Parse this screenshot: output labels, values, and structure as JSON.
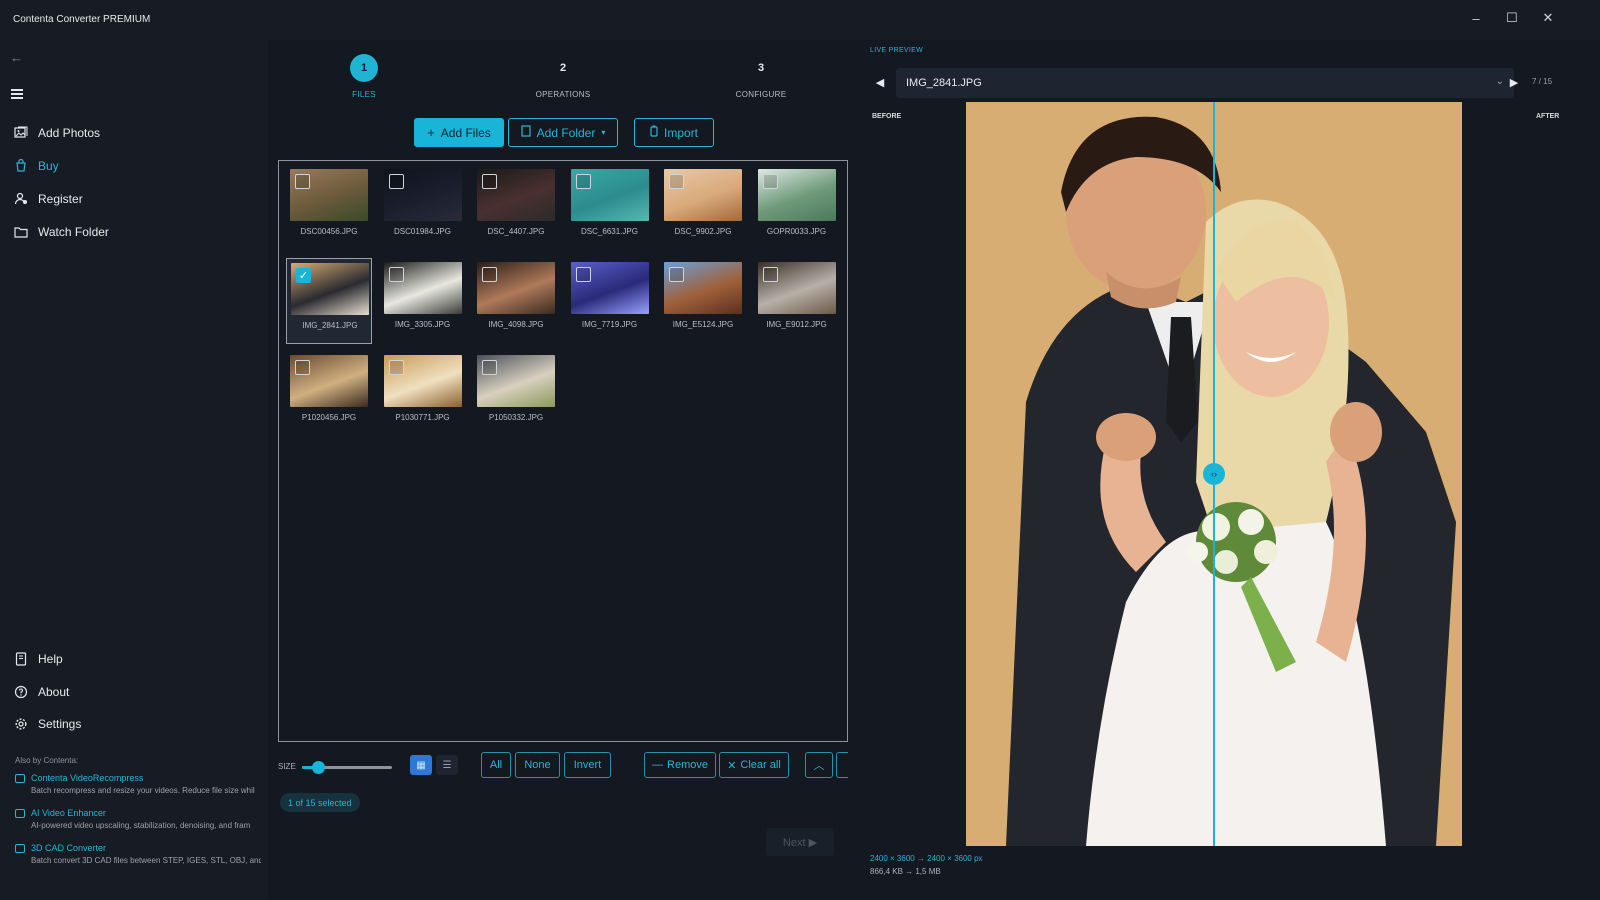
{
  "app": {
    "title": "Contenta Converter PREMIUM"
  },
  "window_controls": {
    "minimize": "–",
    "maximize": "☐",
    "close": "✕"
  },
  "sidebar": {
    "back_icon": "←",
    "top_items": [
      {
        "label": "Add Photos",
        "icon": "photos-icon"
      },
      {
        "label": "Buy",
        "icon": "buy-icon"
      },
      {
        "label": "Register",
        "icon": "register-icon"
      },
      {
        "label": "Watch Folder",
        "icon": "folder-icon"
      }
    ],
    "bottom_items": [
      {
        "label": "Help",
        "icon": "help-icon"
      },
      {
        "label": "About",
        "icon": "about-icon"
      },
      {
        "label": "Settings",
        "icon": "gear-icon"
      }
    ],
    "also_label": "Also by Contenta:",
    "promos": [
      {
        "title": "Contenta VideoRecompress",
        "desc": "Batch recompress and resize your videos. Reduce file size whil"
      },
      {
        "title": "AI Video Enhancer",
        "desc": "AI-powered video upscaling, stabilization, denoising, and fram"
      },
      {
        "title": "3D CAD Converter",
        "desc": "Batch convert 3D CAD files between STEP, IGES, STL, OBJ, and"
      }
    ]
  },
  "steps": [
    {
      "num": "1",
      "label": "FILES",
      "active": true
    },
    {
      "num": "2",
      "label": "OPERATIONS",
      "active": false
    },
    {
      "num": "3",
      "label": "CONFIGURE",
      "active": false
    }
  ],
  "toolbar": {
    "add_files": "Add Files",
    "add_folder": "Add Folder",
    "add_folder_caret": "▾",
    "import": "Import"
  },
  "files": [
    {
      "name": "DSC00456.JPG",
      "checked": false,
      "selected": false,
      "colors": [
        "#9a7a5a",
        "#6a5a3a",
        "#3a4a2a"
      ]
    },
    {
      "name": "DSC01984.JPG",
      "checked": false,
      "selected": false,
      "colors": [
        "#10131c",
        "#1a1f2e",
        "#2a2a3a"
      ]
    },
    {
      "name": "DSC_4407.JPG",
      "checked": false,
      "selected": false,
      "colors": [
        "#1a1a1a",
        "#4a3030",
        "#2a2a2a"
      ]
    },
    {
      "name": "DSC_6631.JPG",
      "checked": false,
      "selected": false,
      "colors": [
        "#3aa7a4",
        "#2c8c8e",
        "#57b8b0"
      ]
    },
    {
      "name": "DSC_9902.JPG",
      "checked": false,
      "selected": false,
      "colors": [
        "#e7c9a8",
        "#d9a97a",
        "#a06a3a"
      ]
    },
    {
      "name": "GOPR0033.JPG",
      "checked": false,
      "selected": false,
      "colors": [
        "#dce8e2",
        "#6e9a7a",
        "#4a7a5a"
      ]
    },
    {
      "name": "IMG_2841.JPG",
      "checked": true,
      "selected": true,
      "colors": [
        "#d6ad72",
        "#2a2a30",
        "#e8e0d0"
      ]
    },
    {
      "name": "IMG_3305.JPG",
      "checked": false,
      "selected": false,
      "colors": [
        "#1a1a1a",
        "#e8e8e0",
        "#3a3a3a"
      ]
    },
    {
      "name": "IMG_4098.JPG",
      "checked": false,
      "selected": false,
      "colors": [
        "#2a1e18",
        "#b07a5a",
        "#3a2a20"
      ]
    },
    {
      "name": "IMG_7719.JPG",
      "checked": false,
      "selected": false,
      "colors": [
        "#5a60c8",
        "#2a2a7a",
        "#9aa0ff"
      ]
    },
    {
      "name": "IMG_E5124.JPG",
      "checked": false,
      "selected": false,
      "colors": [
        "#6aa0d8",
        "#a0603a",
        "#5a3020"
      ]
    },
    {
      "name": "IMG_E9012.JPG",
      "checked": false,
      "selected": false,
      "colors": [
        "#3a3028",
        "#b8b0a8",
        "#6a5a4a"
      ]
    },
    {
      "name": "P1020456.JPG",
      "checked": false,
      "selected": false,
      "colors": [
        "#6a4a30",
        "#d0b080",
        "#3a2a20"
      ]
    },
    {
      "name": "P1030771.JPG",
      "checked": false,
      "selected": false,
      "colors": [
        "#c89a58",
        "#f0e0c0",
        "#8a6030"
      ]
    },
    {
      "name": "P1050332.JPG",
      "checked": false,
      "selected": false,
      "colors": [
        "#4a5058",
        "#d8d0c0",
        "#8a9a5a"
      ]
    }
  ],
  "bottom": {
    "size_label": "SIZE",
    "size_value": 0.18,
    "all": "All",
    "none": "None",
    "invert": "Invert",
    "remove": "Remove",
    "clear_all": "Clear all",
    "selected_count": "1 of 15 selected",
    "next": "Next ▶"
  },
  "preview": {
    "label": "LIVE PREVIEW",
    "file": "IMG_2841.JPG",
    "counter": "7 / 15",
    "before": "BEFORE",
    "after": "AFTER",
    "split": 0.5,
    "dims": "2400 × 3600  →  2400 × 3600 px",
    "size": "866,4 KB  →  1,5 MB"
  },
  "colors": {
    "accent": "#18b5d8",
    "background": "#141921",
    "sidebar": "#171c24"
  }
}
